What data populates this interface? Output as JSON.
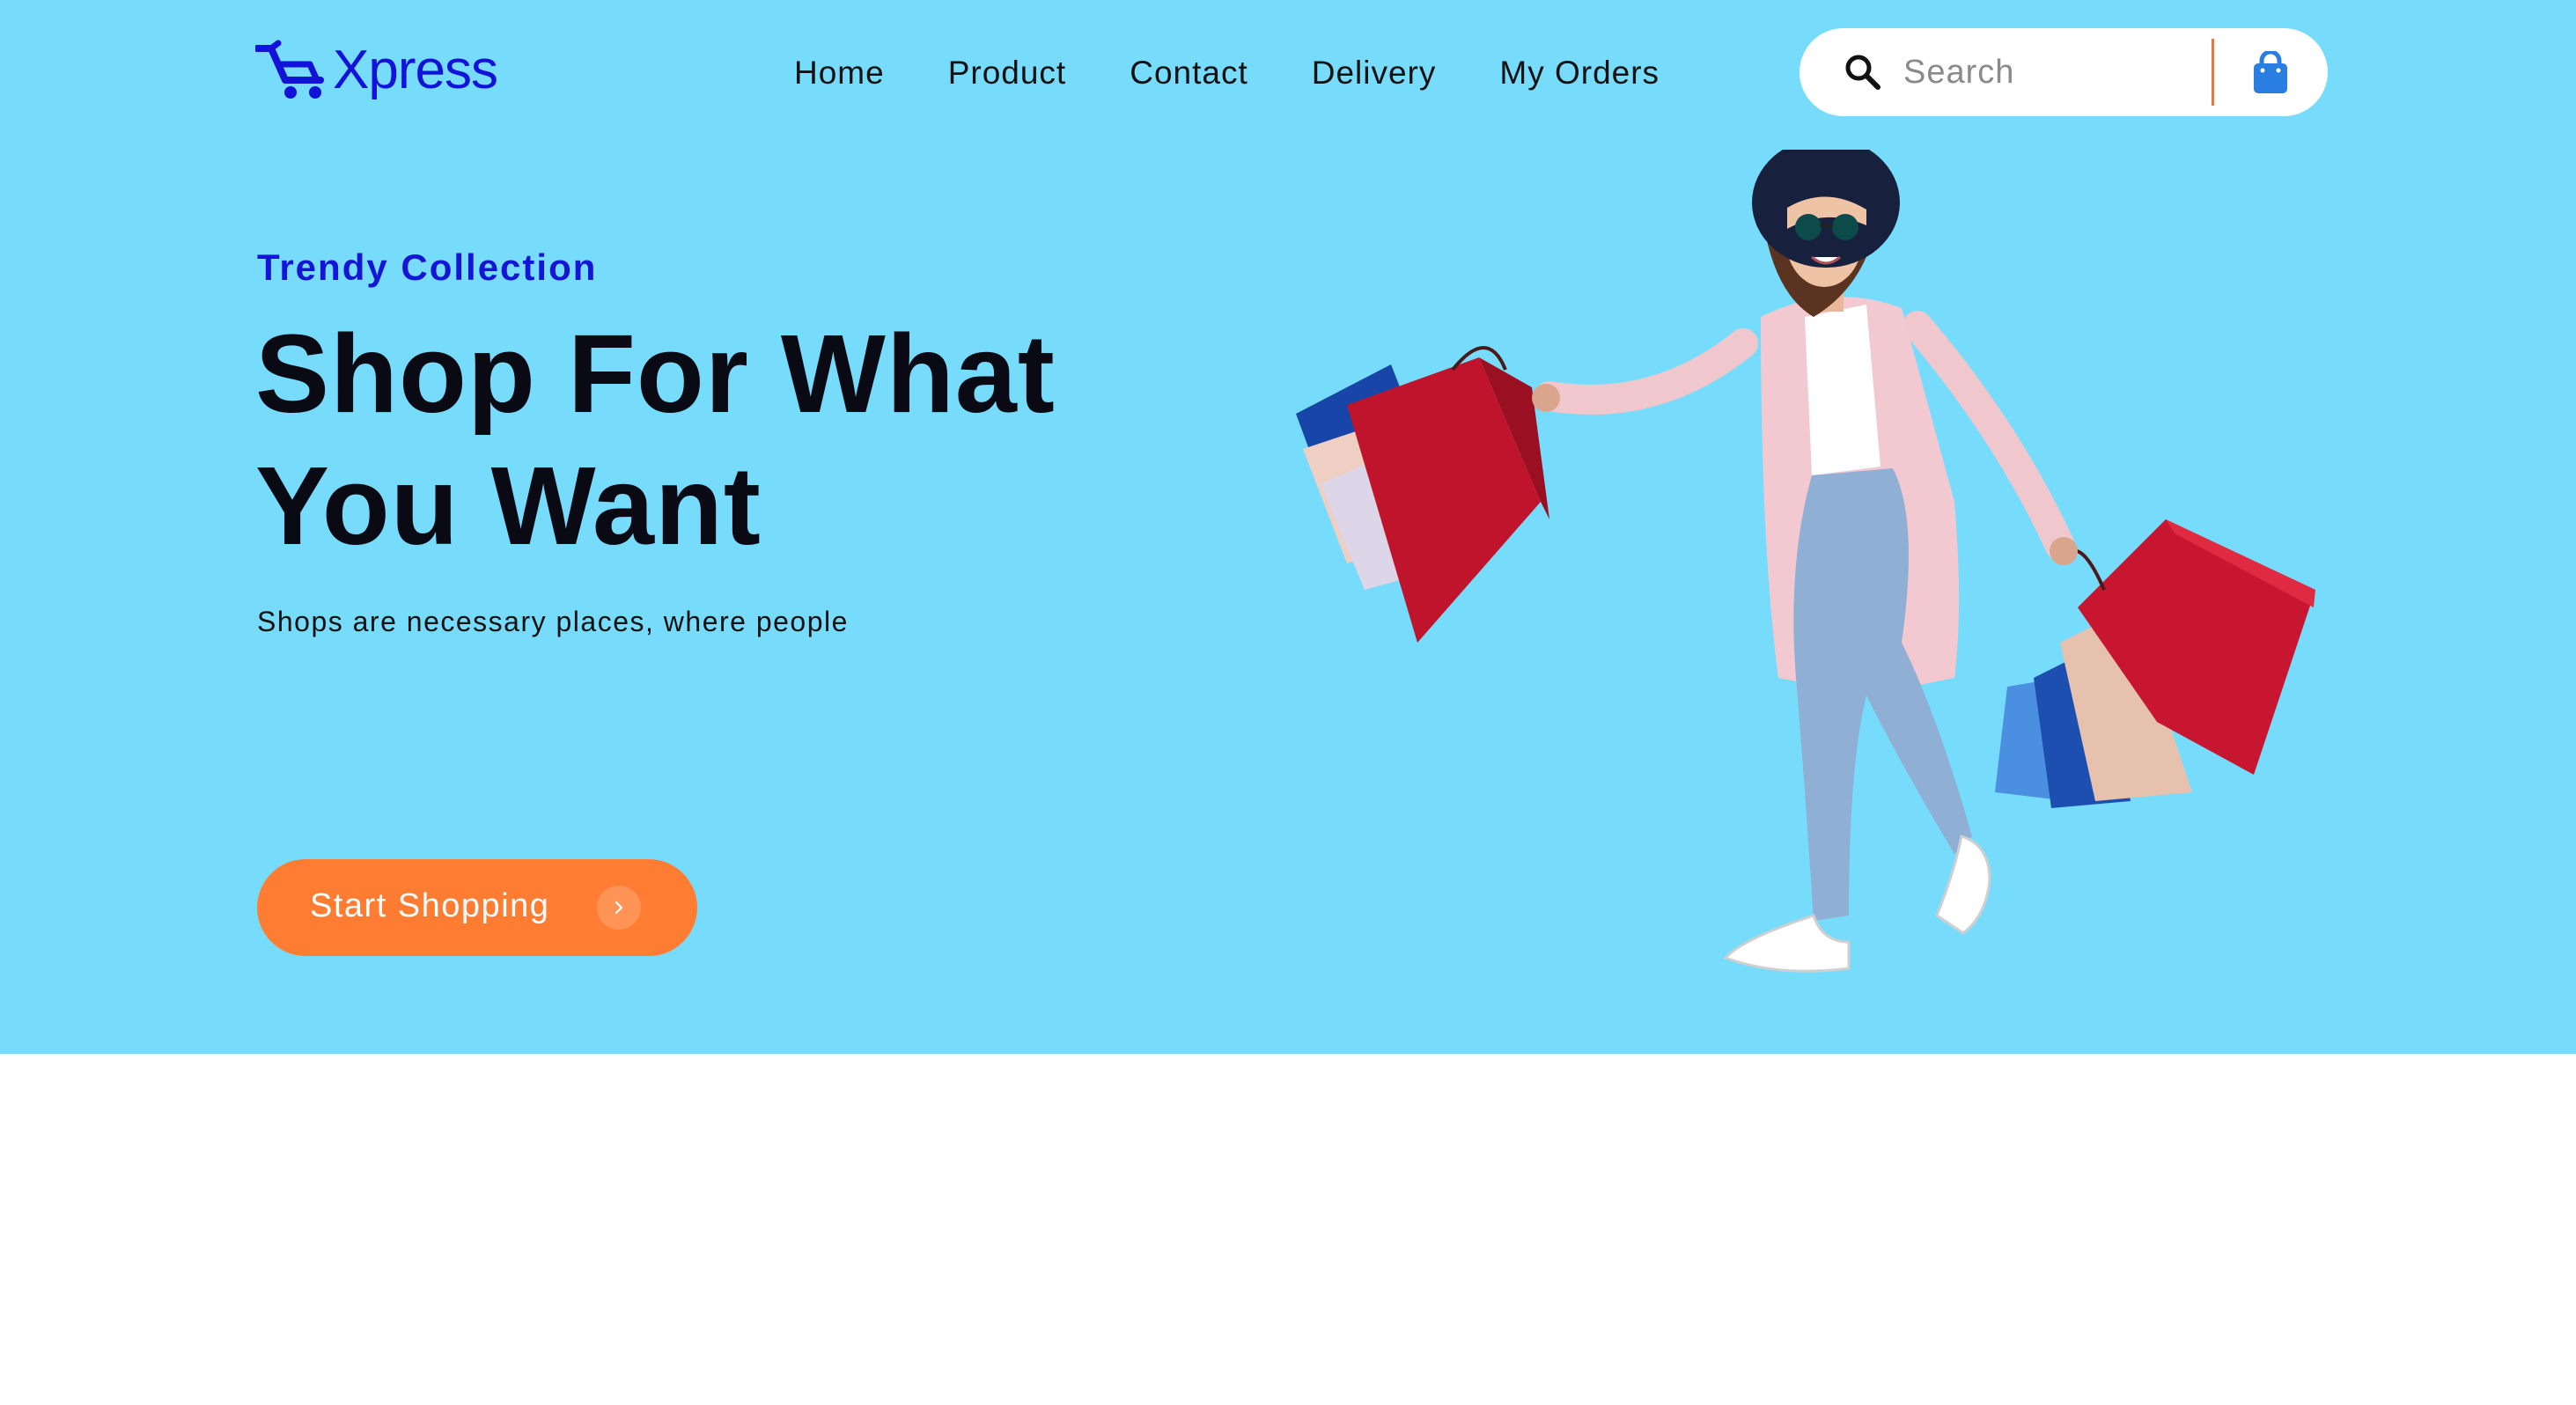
{
  "brand": {
    "name": "Xpress",
    "color": "#1212d8"
  },
  "nav": {
    "items": [
      {
        "label": "Home"
      },
      {
        "label": "Product"
      },
      {
        "label": "Contact"
      },
      {
        "label": "Delivery"
      },
      {
        "label": "My Orders"
      }
    ]
  },
  "search": {
    "placeholder": "Search",
    "value": ""
  },
  "icons": {
    "search": "search-icon",
    "cart": "shopping-bag-icon",
    "cta_arrow": "chevron-right-icon",
    "logo": "shopping-cart-icon"
  },
  "hero": {
    "eyebrow": "Trendy Collection",
    "headline_line1": "Shop For What",
    "headline_line2": "You Want",
    "subtext": "Shops are necessary places, where people",
    "cta_label": "Start Shopping"
  },
  "colors": {
    "hero_bg": "#77dcfb",
    "accent_orange": "#ff7d33",
    "accent_blue": "#1515d6",
    "text_dark": "#0a0a14"
  }
}
